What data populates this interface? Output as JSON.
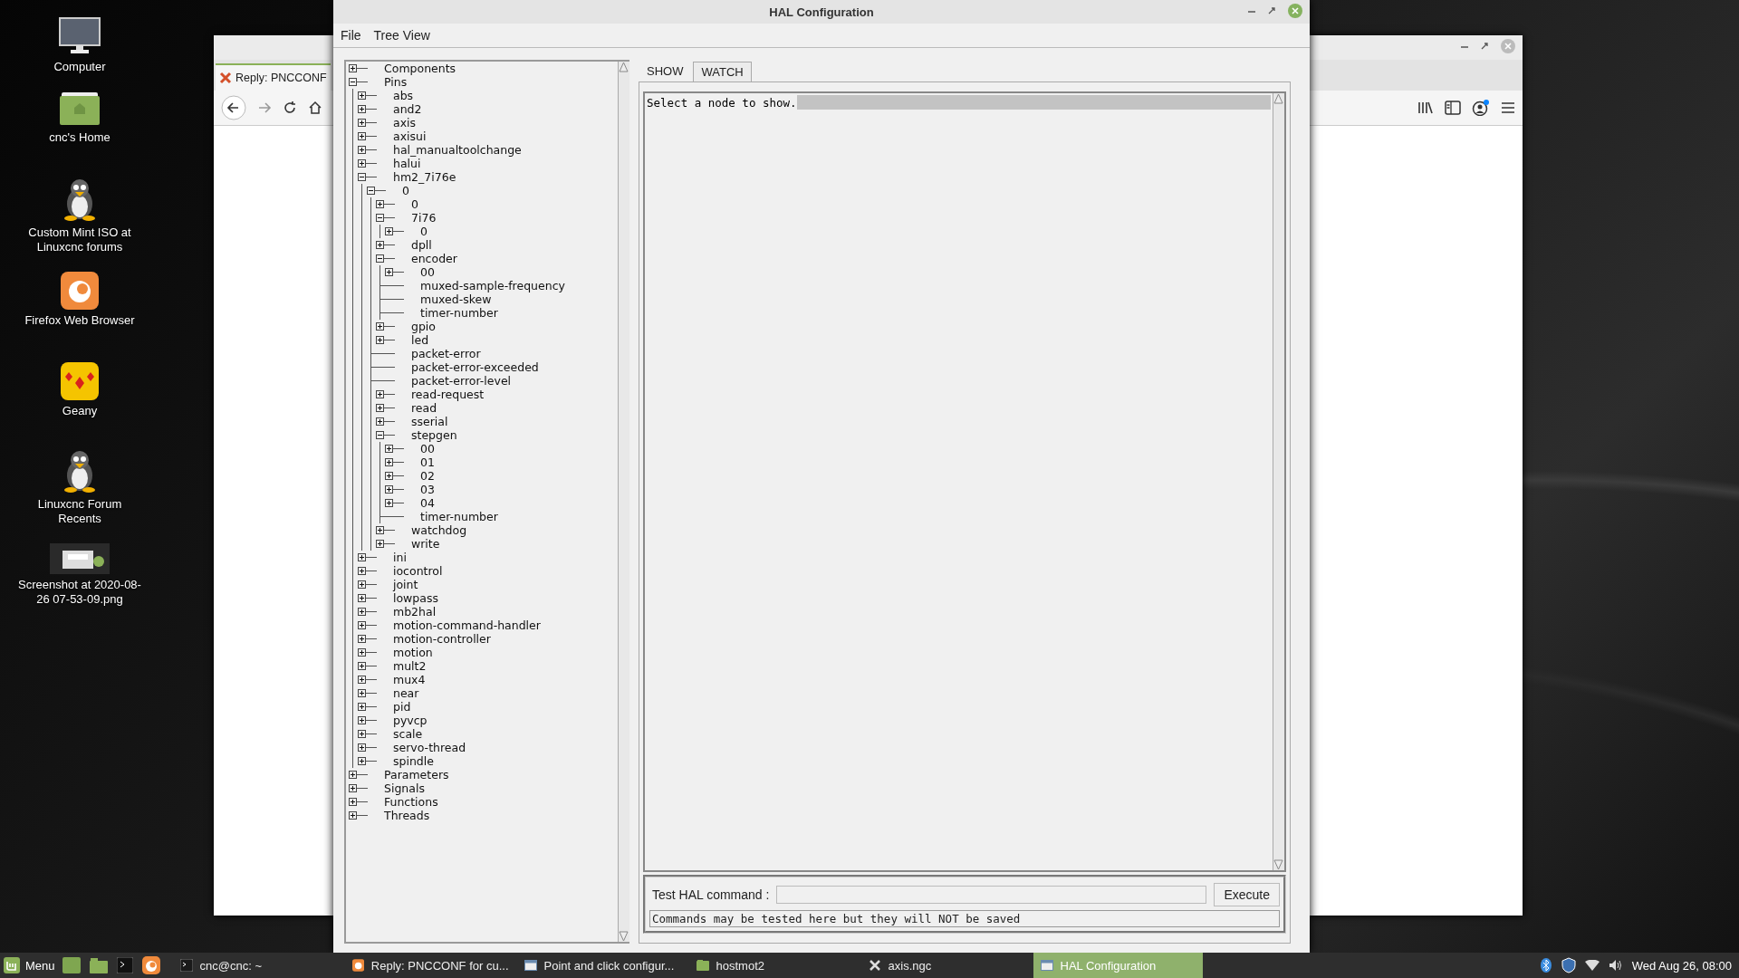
{
  "desktop_icons": [
    {
      "label": "Computer",
      "kind": "computer"
    },
    {
      "label": "cnc's Home",
      "kind": "home"
    },
    {
      "label": "Custom Mint ISO at Linuxcnc forums",
      "kind": "penguin"
    },
    {
      "label": "Firefox Web Browser",
      "kind": "firefox"
    },
    {
      "label": "Geany",
      "kind": "geany"
    },
    {
      "label": "Linuxcnc Forum Recents",
      "kind": "penguin"
    },
    {
      "label": "Screenshot at 2020-08-26 07-53-09.png",
      "kind": "screenshot"
    }
  ],
  "browser_window": {
    "tab_title": "Reply: PNCCONF"
  },
  "hal_window": {
    "title": "HAL Configuration",
    "menu": [
      "File",
      "Tree View"
    ],
    "tree": [
      {
        "label": "Components",
        "kind": "branch",
        "expanded": false
      },
      {
        "label": "Pins",
        "kind": "branch",
        "expanded": true,
        "children": [
          {
            "label": "abs",
            "kind": "branch",
            "expanded": false
          },
          {
            "label": "and2",
            "kind": "branch",
            "expanded": false
          },
          {
            "label": "axis",
            "kind": "branch",
            "expanded": false
          },
          {
            "label": "axisui",
            "kind": "branch",
            "expanded": false
          },
          {
            "label": "hal_manualtoolchange",
            "kind": "branch",
            "expanded": false
          },
          {
            "label": "halui",
            "kind": "branch",
            "expanded": false
          },
          {
            "label": "hm2_7i76e",
            "kind": "branch",
            "expanded": true,
            "children": [
              {
                "label": "0",
                "kind": "branch",
                "expanded": true,
                "children": [
                  {
                    "label": "0",
                    "kind": "branch",
                    "expanded": false
                  },
                  {
                    "label": "7i76",
                    "kind": "branch",
                    "expanded": true,
                    "children": [
                      {
                        "label": "0",
                        "kind": "branch",
                        "expanded": false
                      }
                    ]
                  },
                  {
                    "label": "dpll",
                    "kind": "branch",
                    "expanded": false
                  },
                  {
                    "label": "encoder",
                    "kind": "branch",
                    "expanded": true,
                    "children": [
                      {
                        "label": "00",
                        "kind": "branch",
                        "expanded": false
                      },
                      {
                        "label": "muxed-sample-frequency",
                        "kind": "leaf"
                      },
                      {
                        "label": "muxed-skew",
                        "kind": "leaf"
                      },
                      {
                        "label": "timer-number",
                        "kind": "leaf"
                      }
                    ]
                  },
                  {
                    "label": "gpio",
                    "kind": "branch",
                    "expanded": false
                  },
                  {
                    "label": "led",
                    "kind": "branch",
                    "expanded": false
                  },
                  {
                    "label": "packet-error",
                    "kind": "leaf"
                  },
                  {
                    "label": "packet-error-exceeded",
                    "kind": "leaf"
                  },
                  {
                    "label": "packet-error-level",
                    "kind": "leaf"
                  },
                  {
                    "label": "read-request",
                    "kind": "branch",
                    "expanded": false
                  },
                  {
                    "label": "read",
                    "kind": "branch",
                    "expanded": false
                  },
                  {
                    "label": "sserial",
                    "kind": "branch",
                    "expanded": false
                  },
                  {
                    "label": "stepgen",
                    "kind": "branch",
                    "expanded": true,
                    "children": [
                      {
                        "label": "00",
                        "kind": "branch",
                        "expanded": false
                      },
                      {
                        "label": "01",
                        "kind": "branch",
                        "expanded": false
                      },
                      {
                        "label": "02",
                        "kind": "branch",
                        "expanded": false
                      },
                      {
                        "label": "03",
                        "kind": "branch",
                        "expanded": false
                      },
                      {
                        "label": "04",
                        "kind": "branch",
                        "expanded": false
                      },
                      {
                        "label": "timer-number",
                        "kind": "leaf"
                      }
                    ]
                  },
                  {
                    "label": "watchdog",
                    "kind": "branch",
                    "expanded": false
                  },
                  {
                    "label": "write",
                    "kind": "branch",
                    "expanded": false
                  }
                ]
              }
            ]
          },
          {
            "label": "ini",
            "kind": "branch",
            "expanded": false
          },
          {
            "label": "iocontrol",
            "kind": "branch",
            "expanded": false
          },
          {
            "label": "joint",
            "kind": "branch",
            "expanded": false
          },
          {
            "label": "lowpass",
            "kind": "branch",
            "expanded": false
          },
          {
            "label": "mb2hal",
            "kind": "branch",
            "expanded": false
          },
          {
            "label": "motion-command-handler",
            "kind": "branch",
            "expanded": false
          },
          {
            "label": "motion-controller",
            "kind": "branch",
            "expanded": false
          },
          {
            "label": "motion",
            "kind": "branch",
            "expanded": false
          },
          {
            "label": "mult2",
            "kind": "branch",
            "expanded": false
          },
          {
            "label": "mux4",
            "kind": "branch",
            "expanded": false
          },
          {
            "label": "near",
            "kind": "branch",
            "expanded": false
          },
          {
            "label": "pid",
            "kind": "branch",
            "expanded": false
          },
          {
            "label": "pyvcp",
            "kind": "branch",
            "expanded": false
          },
          {
            "label": "scale",
            "kind": "branch",
            "expanded": false
          },
          {
            "label": "servo-thread",
            "kind": "branch",
            "expanded": false
          },
          {
            "label": "spindle",
            "kind": "branch",
            "expanded": false
          }
        ]
      },
      {
        "label": "Parameters",
        "kind": "branch",
        "expanded": false
      },
      {
        "label": "Signals",
        "kind": "branch",
        "expanded": false
      },
      {
        "label": "Functions",
        "kind": "branch",
        "expanded": false
      },
      {
        "label": "Threads",
        "kind": "branch",
        "expanded": false
      }
    ],
    "tabs": [
      {
        "label": "SHOW",
        "selected": true
      },
      {
        "label": "WATCH",
        "selected": false
      }
    ],
    "output_text": "Select a node to show.",
    "command_label": "Test HAL command :",
    "execute_button": "Execute",
    "status_text": "Commands may be tested here but they will NOT be saved"
  },
  "taskbar": {
    "menu_label": "Menu",
    "launchers": [
      {
        "kind": "desktop"
      },
      {
        "kind": "folder"
      },
      {
        "kind": "terminal"
      },
      {
        "kind": "firefox"
      }
    ],
    "windows": [
      {
        "label": "cnc@cnc: ~",
        "kind": "terminal",
        "selected": false
      },
      {
        "label": "Reply: PNCCONF for cu...",
        "kind": "firefox",
        "selected": false
      },
      {
        "label": "Point and click configur...",
        "kind": "window",
        "selected": false
      },
      {
        "label": "hostmot2",
        "kind": "folder",
        "selected": false
      },
      {
        "label": "axis.ngc",
        "kind": "editor",
        "selected": false
      },
      {
        "label": "HAL Configuration",
        "kind": "window",
        "selected": true
      }
    ],
    "clock": "Wed Aug 26, 08:00"
  }
}
